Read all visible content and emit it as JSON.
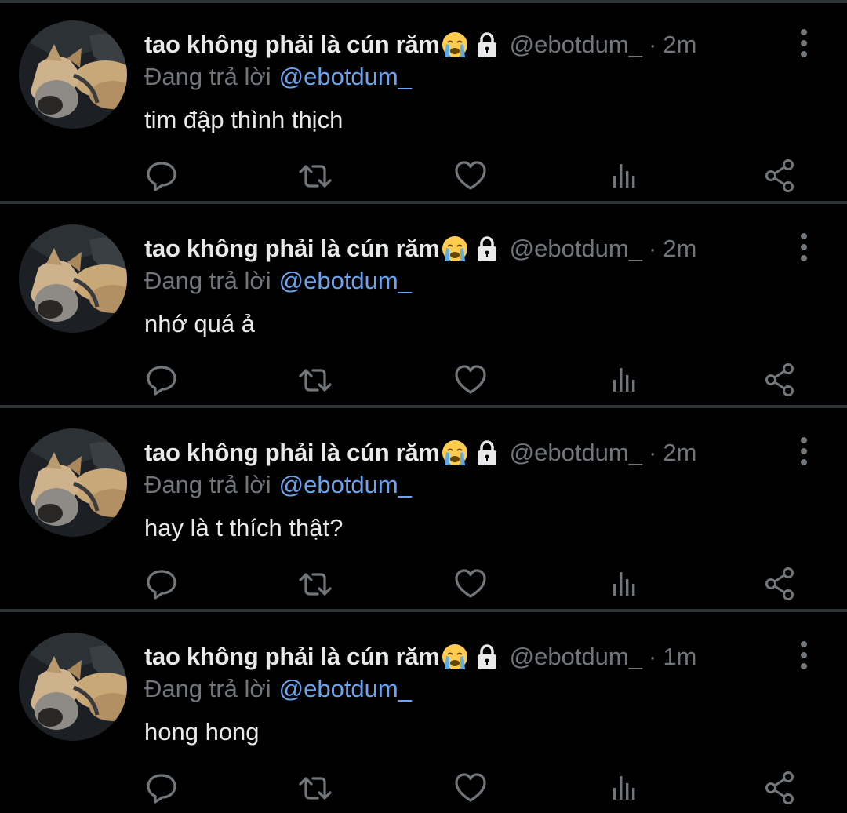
{
  "colors": {
    "background": "#000000",
    "divider": "#2f3336",
    "text_primary": "#e7e9ea",
    "text_secondary": "#71767b",
    "link": "#6ca5ee"
  },
  "icons": {
    "emoji": "loudly-crying-face-icon",
    "lock": "lock-icon",
    "more": "more-vertical-icon",
    "reply": "reply-icon",
    "retweet": "retweet-icon",
    "like": "like-icon",
    "views": "views-icon",
    "share": "share-icon"
  },
  "tweets": [
    {
      "display_name": "tao không phải là cún răm",
      "handle": "@ebotdum_",
      "separator": "·",
      "time": "2m",
      "reply_prefix": "Đang trả lời",
      "reply_to": "@ebotdum_",
      "text": "tim đập thình thịch"
    },
    {
      "display_name": "tao không phải là cún răm",
      "handle": "@ebotdum_",
      "separator": "·",
      "time": "2m",
      "reply_prefix": "Đang trả lời",
      "reply_to": "@ebotdum_",
      "text": "nhớ quá ả"
    },
    {
      "display_name": "tao không phải là cún răm",
      "handle": "@ebotdum_",
      "separator": "·",
      "time": "2m",
      "reply_prefix": "Đang trả lời",
      "reply_to": "@ebotdum_",
      "text": "hay là t thích thật?"
    },
    {
      "display_name": "tao không phải là cún răm",
      "handle": "@ebotdum_",
      "separator": "·",
      "time": "1m",
      "reply_prefix": "Đang trả lời",
      "reply_to": "@ebotdum_",
      "text": "hong hong"
    }
  ]
}
